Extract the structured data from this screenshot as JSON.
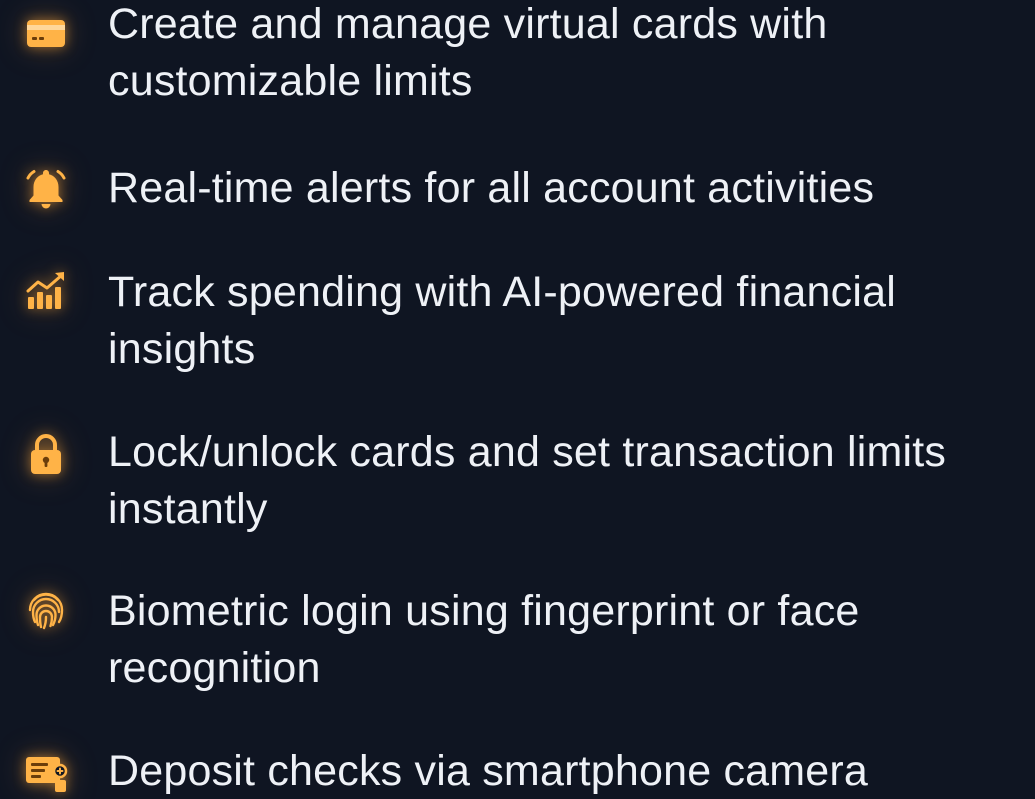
{
  "colors": {
    "background": "#0f1522",
    "text": "#eef1f6",
    "icon_accent": "#ffb347"
  },
  "features": [
    {
      "icon": "credit-card-icon",
      "text": "Create and manage virtual cards with customizable limits"
    },
    {
      "icon": "bell-icon",
      "text": "Real-time alerts for all account activities"
    },
    {
      "icon": "growth-chart-icon",
      "text": "Track spending with AI-powered financial insights"
    },
    {
      "icon": "lock-icon",
      "text": "Lock/unlock cards and set transaction limits instantly"
    },
    {
      "icon": "fingerprint-icon",
      "text": "Biometric login using fingerprint or face recognition"
    },
    {
      "icon": "check-deposit-icon",
      "text": "Deposit checks via smartphone camera"
    }
  ]
}
